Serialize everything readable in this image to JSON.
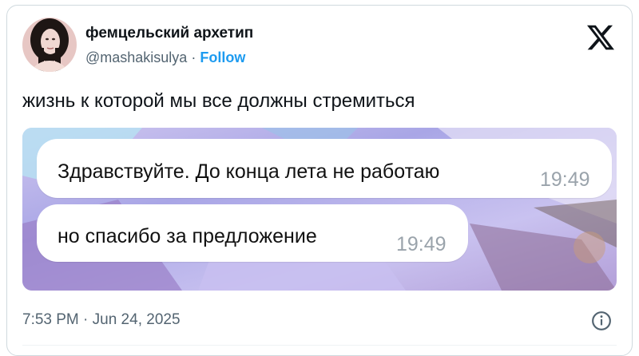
{
  "author": {
    "name": "фемцельский архетип",
    "handle": "@mashakisulya",
    "separator": "·",
    "follow_label": "Follow"
  },
  "tweet": {
    "text": "жизнь к которой мы все должны стремиться",
    "timestamp": "7:53 PM · Jun 24, 2025"
  },
  "media": {
    "messages": [
      {
        "text": "Здравствуйте. До конца лета не работаю",
        "time": "19:49"
      },
      {
        "text": "но спасибо за предложение",
        "time": "19:49"
      }
    ]
  },
  "colors": {
    "accent": "#1d9bf0",
    "text_primary": "#0f1419",
    "text_secondary": "#536471",
    "border": "#cfd9de"
  },
  "icons": {
    "brand": "x-logo-icon",
    "info": "info-icon"
  }
}
